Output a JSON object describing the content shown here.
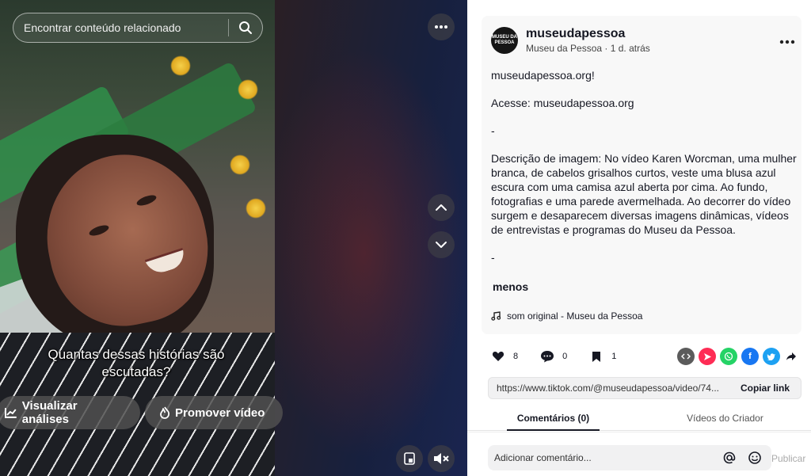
{
  "video": {
    "search_placeholder": "Encontrar conteúdo relacionado",
    "caption": "Quantas dessas histórias são escutadas?",
    "analytics_button": "Visualizar análises",
    "promote_button": "Promover vídeo"
  },
  "post": {
    "avatar_text": "MUSEU DA PESSOA",
    "username": "museudapessoa",
    "subline": "Museu da Pessoa · 1 d. atrás",
    "description": [
      "museudapessoa.org!",
      "Acesse: museudapessoa.org",
      "-",
      "Descrição de imagem: No vídeo Karen Worcman, uma mulher branca, de cabelos grisalhos curtos, veste uma blusa azul escura com uma camisa azul aberta por cima. Ao fundo, fotografias e uma parede avermelhada. Ao decorrer do vídeo surgem e desaparecem diversas imagens dinâmicas, vídeos de entrevistas e programas do Museu da Pessoa.",
      "-"
    ],
    "less_label": "menos",
    "music": "som original - Museu da Pessoa",
    "likes": "8",
    "comments": "0",
    "saves": "1",
    "link": "https://www.tiktok.com/@museudapessoa/video/74...",
    "copy_label": "Copiar link"
  },
  "tabs": [
    "Comentários (0)",
    "Vídeos do Criador"
  ],
  "comment": {
    "placeholder": "Adicionar comentário...",
    "publish_label": "Publicar"
  },
  "colors": {
    "embed": "#5b5b5b",
    "telegram": "#fe2c55",
    "whatsapp": "#25d366",
    "facebook": "#1877f2",
    "twitter": "#1da1f2"
  }
}
